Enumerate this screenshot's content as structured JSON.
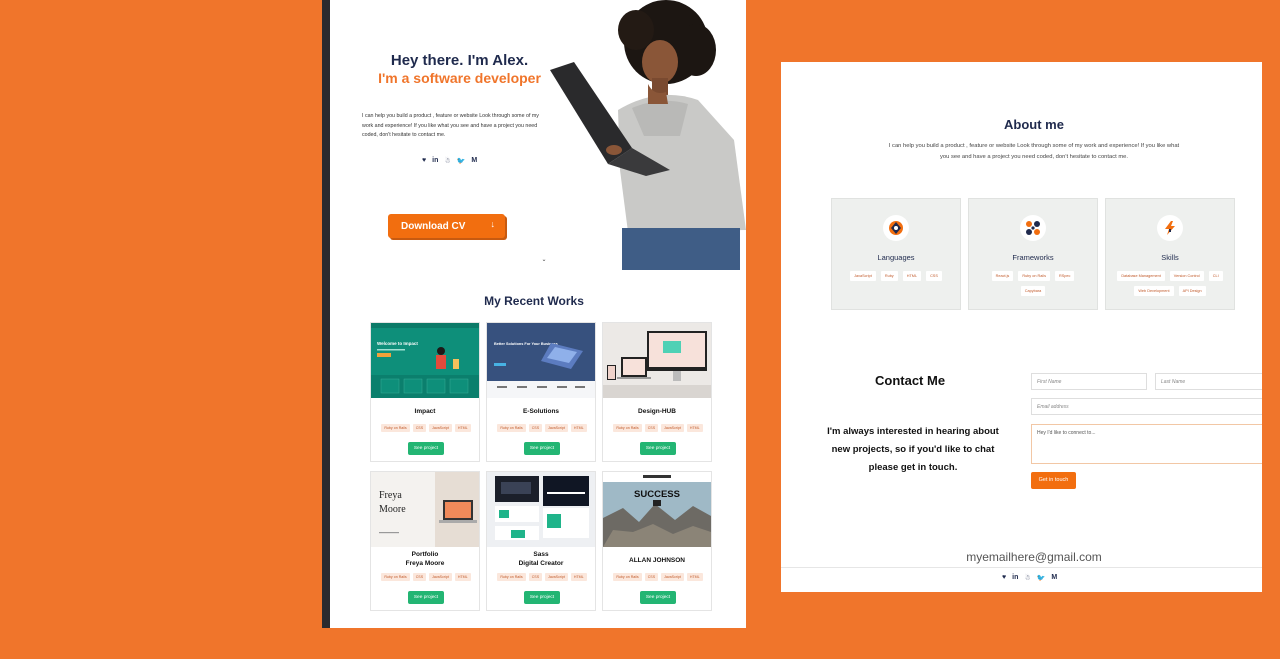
{
  "hero": {
    "title_line1": "Hey there. I'm Alex.",
    "title_line2": "I'm a software developer",
    "description": "I can help you build a product , feature or website Look through some of my work and experience! If you like what you see and have a project you need coded, don't hesitate to contact me.",
    "social_icons": [
      "angellist-icon",
      "linkedin-icon",
      "github-icon",
      "twitter-icon",
      "medium-icon"
    ],
    "social_glyphs": [
      "♥",
      "in",
      "☃",
      "🐦",
      "M"
    ],
    "download_label": "Download CV",
    "scroll_glyph": "⌄"
  },
  "works": {
    "title": "My Recent Works",
    "see_label": "See project",
    "items": [
      {
        "name": "Impact",
        "tags": [
          "Ruby on Rails",
          "CSS",
          "JavaScript",
          "HTML"
        ],
        "thumb_text": "Welcome to Impact"
      },
      {
        "name": "E-Solutions",
        "tags": [
          "Ruby on Rails",
          "CSS",
          "JavaScript",
          "HTML"
        ],
        "thumb_text": "Better Solutions For Your Business"
      },
      {
        "name": "Design-HUB",
        "tags": [
          "Ruby on Rails",
          "CSS",
          "JavaScript",
          "HTML"
        ],
        "thumb_text": ""
      },
      {
        "name": "Portfolio\nFreya Moore",
        "tags": [
          "Ruby on Rails",
          "CSS",
          "JavaScript",
          "HTML"
        ],
        "thumb_text": "Freya Moore"
      },
      {
        "name": "Sass\nDigital Creator",
        "tags": [
          "Ruby on Rails",
          "CSS",
          "JavaScript",
          "HTML"
        ],
        "thumb_text": ""
      },
      {
        "name": "ALLAN JOHNSON",
        "tags": [
          "Ruby on Rails",
          "CSS",
          "JavaScript",
          "HTML"
        ],
        "thumb_text": "SUCCESS"
      }
    ]
  },
  "about": {
    "title": "About me",
    "description": "I can help you build a product , feature or website Look through some of my work and experience! If you like what you see and have a project you need coded, don't hesitate to contact me.",
    "cards": [
      {
        "title": "Languages",
        "icon": "languages-icon",
        "tags": [
          "JavaScript",
          "Ruby",
          "HTML",
          "CSS"
        ]
      },
      {
        "title": "Frameworks",
        "icon": "frameworks-icon",
        "tags": [
          "React.js",
          "Ruby on Rails",
          "RSpec",
          "Capybara"
        ]
      },
      {
        "title": "Skills",
        "icon": "skills-icon",
        "tags": [
          "Database Management",
          "Version Control",
          "CLI",
          "Web Development",
          "API Design"
        ]
      }
    ]
  },
  "contact": {
    "title": "Contact Me",
    "message": "I'm always interested in hearing about new projects, so if you'd like to chat please get in touch.",
    "first_name_placeholder": "First Name",
    "last_name_placeholder": "Last Name",
    "email_placeholder": "Email address",
    "message_placeholder": "Hey I'd like to connect to...",
    "submit_label": "Get in touch"
  },
  "footer": {
    "email": "myemailhere@gmail.com",
    "social_glyphs": [
      "♥",
      "in",
      "☃",
      "🐦",
      "M"
    ]
  },
  "colors": {
    "background": "#f0752b",
    "accent": "#f26e0f",
    "navy": "#1f2a4d",
    "green": "#23b573"
  }
}
